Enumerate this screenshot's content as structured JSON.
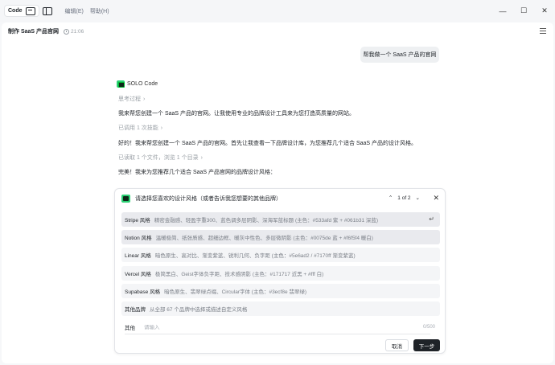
{
  "titlebar": {
    "app_label": "Code",
    "menus": [
      "编辑(E)",
      "帮助(H)"
    ],
    "controls": {
      "minimize": "—",
      "maximize": "☐",
      "close": "✕"
    }
  },
  "header": {
    "title": "制作 SaaS 产品官网",
    "time": "21:06"
  },
  "conversation": {
    "user_message": "帮我做一个 SaaS 产品的官网",
    "assistant_name": "SOLO Code",
    "thinking": "思考过程",
    "line1": "我来帮您创建一个 SaaS 产品的官网。让我使用专业的品牌设计工具来为您打造高质量的网站。",
    "tool_used": "已调用 1 次技能",
    "line2": "好的！我来帮您创建一个 SaaS 产品的官网。首先让我查看一下品牌设计库，为您推荐几个适合 SaaS 产品的设计风格。",
    "files_read": "已读取 1 个文件，浏览 1 个目录",
    "line3": "完美！我来为您推荐几个适合 SaaS 产品官网的品牌设计风格："
  },
  "dialog": {
    "title": "请选择您喜欢的设计风格（或者告诉我您想要的其他品牌）",
    "pager": "1 of 2",
    "options": [
      {
        "name": "Stripe 风格",
        "desc": "精密金融感、轻盈字重300、蓝色调多层阴影、深海军蓝标题 (主色：#533afd 紫 + #061b31 深蓝)"
      },
      {
        "name": "Notion 风格",
        "desc": "温暖极简、纸张质感、超细边框、暖灰中性色、多层微阴影 (主色：#0075de 蓝 + #f6f5f4 暖白)"
      },
      {
        "name": "Linear 风格",
        "desc": "暗色原生、高对比、渐变紫蓝、锐利几何、负字距 (主色：#5e6ad2 / #7170ff 渐变紫蓝)"
      },
      {
        "name": "Vercel 风格",
        "desc": "极简黑白、Geist字体负字距、技术感阴影 (主色：#171717 近黑 + #fff 白)"
      },
      {
        "name": "Supabase 风格",
        "desc": "暗色原生、翡翠绿点缀、Circular字体 (主色：#3ecf8e 翡翠绿)"
      },
      {
        "name": "其他品牌",
        "desc": "从全部 67 个品牌中选择或描述自定义风格"
      }
    ],
    "other_label": "其他",
    "other_placeholder": "请输入",
    "counter": "0/500",
    "cancel": "取消",
    "next": "下一步"
  }
}
